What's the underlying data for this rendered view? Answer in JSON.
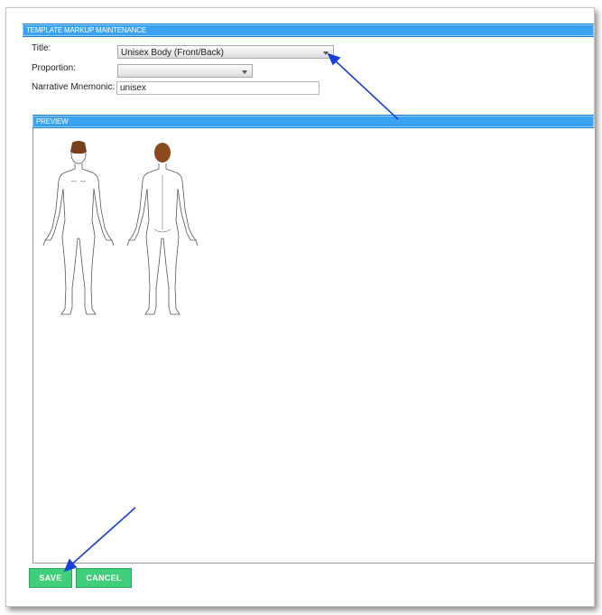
{
  "header": {
    "title": "TEMPLATE MARKUP MAINTENANCE"
  },
  "form": {
    "title_label": "Title:",
    "title_value": "Unisex Body (Front/Back)",
    "proportion_label": "Proportion:",
    "proportion_value": "",
    "mnemonic_label": "Narrative Mnemonic:",
    "mnemonic_value": "unisex"
  },
  "preview": {
    "title": "PREVIEW"
  },
  "actions": {
    "save_label": "SAVE",
    "cancel_label": "CANCEL"
  },
  "colors": {
    "bar": "#3aa2f2",
    "button": "#3fcf7a",
    "arrow": "#1a3fd6",
    "hair_front": "#7a3e18",
    "hair_back": "#8a4a1e"
  }
}
